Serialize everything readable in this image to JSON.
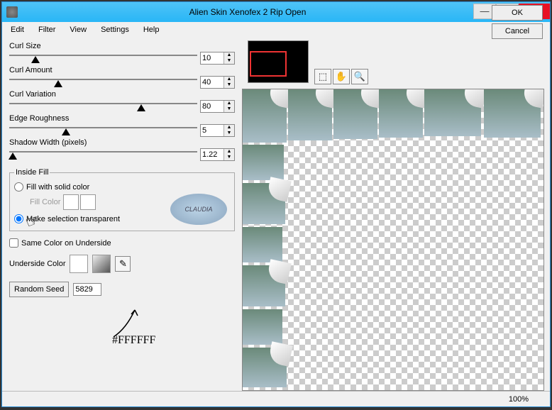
{
  "window": {
    "title": "Alien Skin Xenofex 2 Rip Open"
  },
  "menu": {
    "edit": "Edit",
    "filter": "Filter",
    "view": "View",
    "settings": "Settings",
    "help": "Help"
  },
  "sliders": {
    "curl_size": {
      "label": "Curl Size",
      "value": "10",
      "pos": 14
    },
    "curl_amount": {
      "label": "Curl Amount",
      "value": "40",
      "pos": 26
    },
    "curl_variation": {
      "label": "Curl Variation",
      "value": "80",
      "pos": 70
    },
    "edge_roughness": {
      "label": "Edge Roughness",
      "value": "5",
      "pos": 30
    },
    "shadow_width": {
      "label": "Shadow Width (pixels)",
      "value": "1.22",
      "pos": 2
    }
  },
  "inside_fill": {
    "legend": "Inside Fill",
    "opt_solid": "Fill with solid color",
    "fill_color_label": "Fill Color",
    "opt_transparent": "Make selection transparent",
    "logo_text": "CLAUDIA"
  },
  "same_color_label": "Same Color on Underside",
  "underside_label": "Underside Color",
  "underside_color_hex": "#FFFFFF",
  "random": {
    "button": "Random Seed",
    "value": "5829"
  },
  "annotation": "#FFFFFF",
  "buttons": {
    "ok": "OK",
    "cancel": "Cancel"
  },
  "status": {
    "zoom": "100%"
  }
}
